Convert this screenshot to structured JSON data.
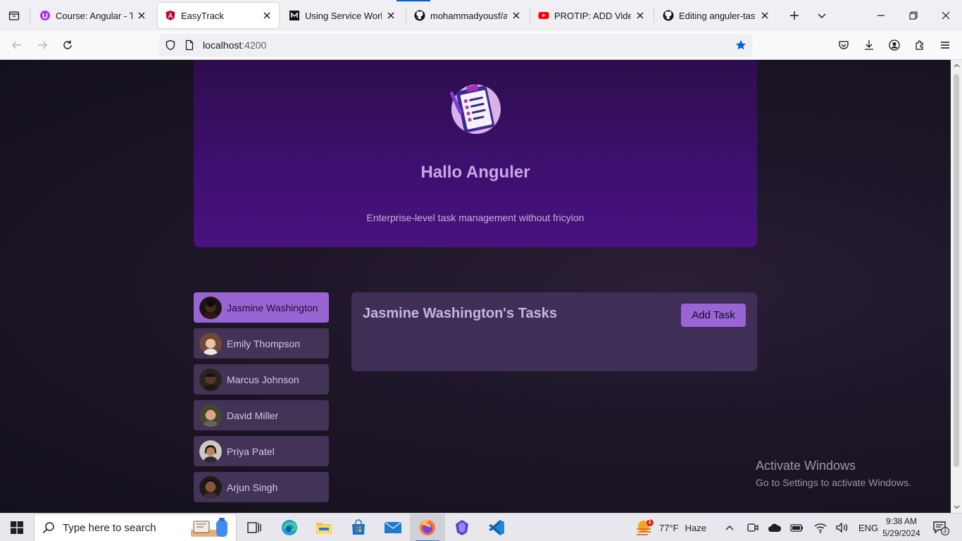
{
  "browser": {
    "tabs": [
      {
        "title": "Course: Angular - The",
        "active": false
      },
      {
        "title": "EasyTrack",
        "active": true
      },
      {
        "title": "Using Service Workers",
        "active": false
      },
      {
        "title": "mohammadyousf/ang",
        "active": false
      },
      {
        "title": "PROTIP: ADD Videos/G",
        "active": false
      },
      {
        "title": "Editing anguler-task/R",
        "active": false
      }
    ],
    "url_host": "localhost",
    "url_port": ":4200",
    "bookmark_starred": true
  },
  "app": {
    "title": "Hallo Anguler",
    "subtitle": "Enterprise-level task management without fricyion",
    "users": [
      {
        "name": "Jasmine Washington",
        "selected": true
      },
      {
        "name": "Emily Thompson",
        "selected": false
      },
      {
        "name": "Marcus Johnson",
        "selected": false
      },
      {
        "name": "David Miller",
        "selected": false
      },
      {
        "name": "Priya Patel",
        "selected": false
      },
      {
        "name": "Arjun Singh",
        "selected": false
      }
    ],
    "tasks_title": "Jasmine Washington's Tasks",
    "add_task_label": "Add Task"
  },
  "watermark": {
    "line1": "Activate Windows",
    "line2": "Go to Settings to activate Windows."
  },
  "taskbar": {
    "search_placeholder": "Type here to search",
    "weather_temp": "77°F",
    "weather_desc": "Haze",
    "weather_alert": "1",
    "language": "ENG",
    "time": "9:38 AM",
    "date": "5/29/2024",
    "notifications": "3"
  },
  "colors": {
    "accent": "#9965d4",
    "hero_bg": "#3d1070",
    "panel_bg": "#3f2e56"
  }
}
